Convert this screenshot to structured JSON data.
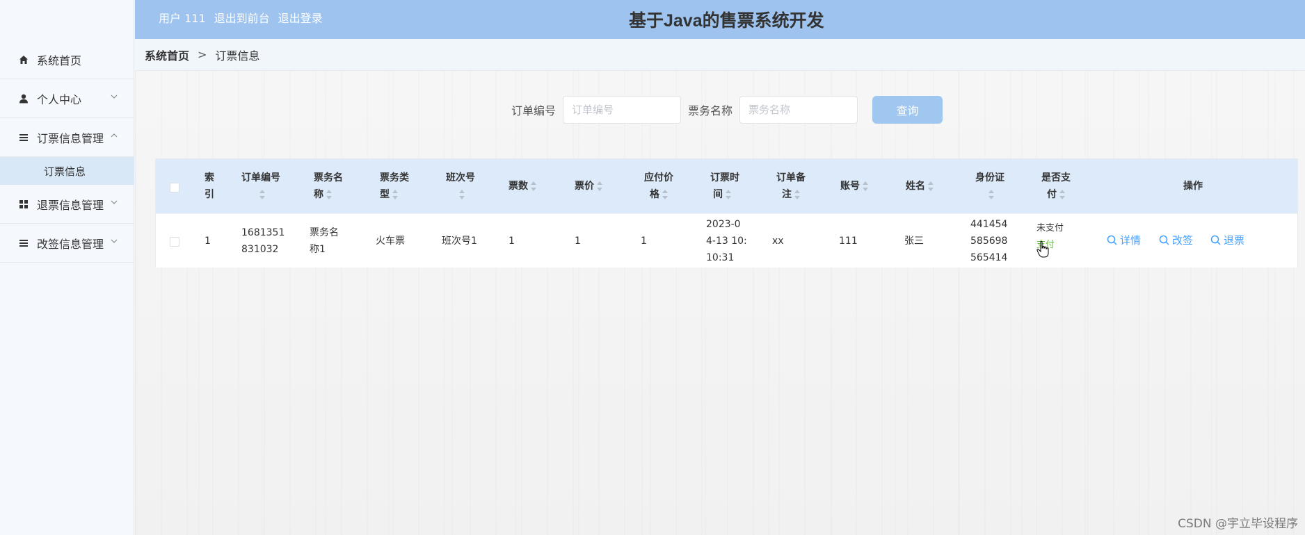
{
  "header": {
    "user": "用户 111",
    "to_front": "退出到前台",
    "logout": "退出登录",
    "title": "基于Java的售票系统开发"
  },
  "sidebar": {
    "items": [
      {
        "label": "系统首页",
        "icon": "home-icon"
      },
      {
        "label": "个人中心",
        "icon": "user-icon"
      },
      {
        "label": "订票信息管理",
        "icon": "menu-icon",
        "expanded": true
      },
      {
        "label": "订票信息"
      },
      {
        "label": "退票信息管理",
        "icon": "grid-icon"
      },
      {
        "label": "改签信息管理",
        "icon": "menu-icon"
      }
    ]
  },
  "breadcrumb": {
    "home": "系统首页",
    "sep": ">",
    "current": "订票信息"
  },
  "search": {
    "order_label": "订单编号",
    "order_placeholder": "订单编号",
    "ticket_label": "票务名称",
    "ticket_placeholder": "票务名称",
    "button": "查询"
  },
  "table": {
    "headers": {
      "index": [
        "索",
        "引"
      ],
      "order_no": [
        "订单编号"
      ],
      "ticket_name": [
        "票务名",
        "称"
      ],
      "ticket_type": [
        "票务类",
        "型"
      ],
      "train_no": [
        "班次号"
      ],
      "count": [
        "票数"
      ],
      "price": [
        "票价"
      ],
      "payable": [
        "应付价",
        "格"
      ],
      "order_time": [
        "订票时",
        "间"
      ],
      "remark": [
        "订单备",
        "注"
      ],
      "account": [
        "账号"
      ],
      "name": [
        "姓名"
      ],
      "id_card": [
        "身份证"
      ],
      "paid": [
        "是否支",
        "付"
      ],
      "actions": "操作"
    },
    "rows": [
      {
        "index": "1",
        "order_no": [
          "1681351",
          "831032"
        ],
        "ticket_name": [
          "票务名",
          "称1"
        ],
        "ticket_type": "火车票",
        "train_no": "班次号1",
        "count": "1",
        "price": "1",
        "payable": "1",
        "order_time": [
          "2023-0",
          "4-13 10:",
          "10:31"
        ],
        "remark": "xx",
        "account": "111",
        "name": "张三",
        "id_card": [
          "441454",
          "585698",
          "565414"
        ],
        "paid": "未支付",
        "pay_link": "支付",
        "actions": {
          "detail": "详情",
          "change": "改签",
          "refund": "退票"
        }
      }
    ]
  },
  "watermark": "CSDN @宇立毕设程序",
  "colors": {
    "header_bg": "#9dc3ee",
    "accent": "#409eff",
    "pay": "#67c23a"
  }
}
